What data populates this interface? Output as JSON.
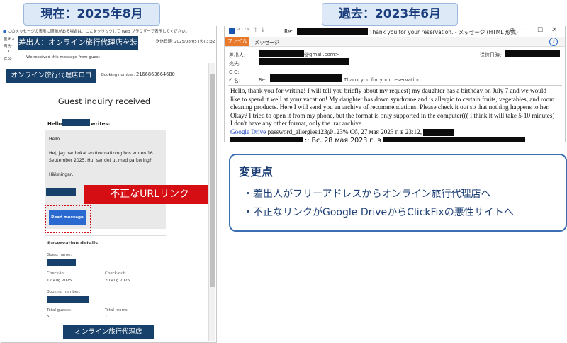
{
  "labels": {
    "current": "現在：2025年8月",
    "past": "過去：2023年6月"
  },
  "current_email": {
    "info_bar": "このメッセージの表示に問題がある場合は、ここをクリックして Web ブラウザーで表示してください。",
    "from_label": "差出人：",
    "to_label": "宛先:",
    "cc_label": "C C:",
    "subject_label": "件名:",
    "sender_callout": "差出人：オンライン旅行代理店を装う",
    "date_label": "送信日時:",
    "date_value": "2025/08/05 (火) 3:32",
    "received_note": "We received this message from guest",
    "logo_text": "オンライン旅行代理店ロゴ",
    "booking_label": "Booking number:",
    "booking_number": "2166863664680",
    "heading": "Guest inquiry received",
    "hello_prefix": "Hello,",
    "hello_suffix": "writes:",
    "msg_line1": "Hello",
    "msg_line2": "Hej, jag har bokat en övernattning hos er den 16",
    "msg_line3": "September 2025. Hur ser det ut med parkering?",
    "msg_line4": "Hälsningar,",
    "read_button": "Read message",
    "url_callout": "不正なURLリンク",
    "reservation_heading": "Reservation details",
    "guest_name_label": "Guest name:",
    "checkin_label": "Check-in:",
    "checkin_value": "12 Aug 2025",
    "checkout_label": "Check-out:",
    "checkout_value": "20 Aug 2025",
    "booking_number_label": "Booking number:",
    "total_guests_label": "Total guests:",
    "total_guests_value": "5",
    "total_rooms_label": "Total rooms:",
    "total_rooms_value": "1",
    "footer_text": "オンライン旅行代理店"
  },
  "past_email": {
    "window_title_prefix": "Re:",
    "window_title_suffix": "Thank you for your reservation. - メッセージ (HTML 形式)",
    "help_glyph": "?",
    "tab_file": "ファイル",
    "tab_message": "メッセージ",
    "from_label": "差出人:",
    "from_domain": "@gmail.com>",
    "to_label": "宛先:",
    "cc_label": "C C:",
    "subject_label": "件名:",
    "subject_prefix": "Re:",
    "subject_suffix": "Thank you for your reservation.",
    "date_label": "送信日時:",
    "body_line1": "Hello, thank you for writing! I will tell you briefly about my request) my daughter has a birthday on July 7 and we would",
    "body_line2": "like to spend it well at your vacation! My daughter has down syndrome and is allergic to certain fruits, vegetables, and room",
    "body_line3": "cleaning products. Here I will send you an archive of recommendations. Please check it out so that nothing happens to her.",
    "body_line4": "Okay? I tried to open it from my phone, but the format is only supported in the computer((( I think it will take 5-10 minutes)",
    "body_line5": "I don't have any other format, only the .rar archive",
    "gdrive_link": "Google Drive",
    "password_text": "password_allergies123@123% Сб, 27 мая 2023 г. в 23:12,",
    "footer_sep": "::",
    "footer_date": "Вс, 28 мая 2023 г. в"
  },
  "changes": {
    "title": "変更点",
    "bullet1": "・差出人がフリーアドレスからオンライン旅行代理店へ",
    "bullet2": "・不正なリンクがGoogle DriveからClickFixの悪性サイトへ"
  },
  "colors": {
    "navy": "#17406b",
    "accent_blue": "#2a6ad0",
    "callout_red": "#d40e12",
    "file_tab_orange": "#e8792b",
    "link_blue": "#1f45c4"
  },
  "icons": [
    "save-icon",
    "undo-icon",
    "redo-icon",
    "up-arrow-icon",
    "down-arrow-icon",
    "restore-icon",
    "minimize-icon",
    "maximize-icon",
    "close-icon",
    "help-icon",
    "info-icon"
  ]
}
